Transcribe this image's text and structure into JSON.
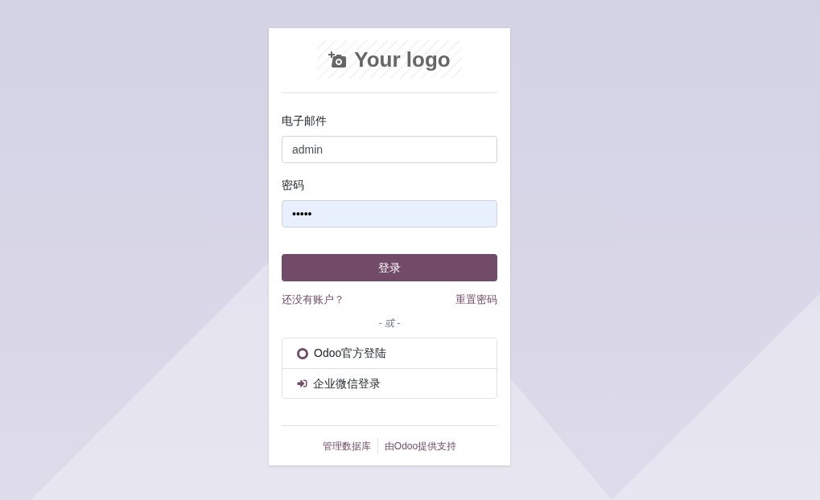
{
  "logo": {
    "text": "Your logo"
  },
  "login_form": {
    "fields": [
      {
        "label": "电子邮件",
        "value": "admin",
        "autofilled": false
      },
      {
        "label": "密码",
        "value": "•••••",
        "autofilled": true
      }
    ],
    "submit_button": "登录",
    "signup_link": "还没有账户？",
    "reset_link": "重置密码",
    "separator": "- 或 -",
    "providers": [
      {
        "kind": "odoo",
        "label": "Odoo官方登陆"
      },
      {
        "kind": "signin",
        "label": "企业微信登录"
      }
    ]
  },
  "footer": {
    "links": [
      "管理数据库",
      "由Odoo提供支持"
    ]
  }
}
